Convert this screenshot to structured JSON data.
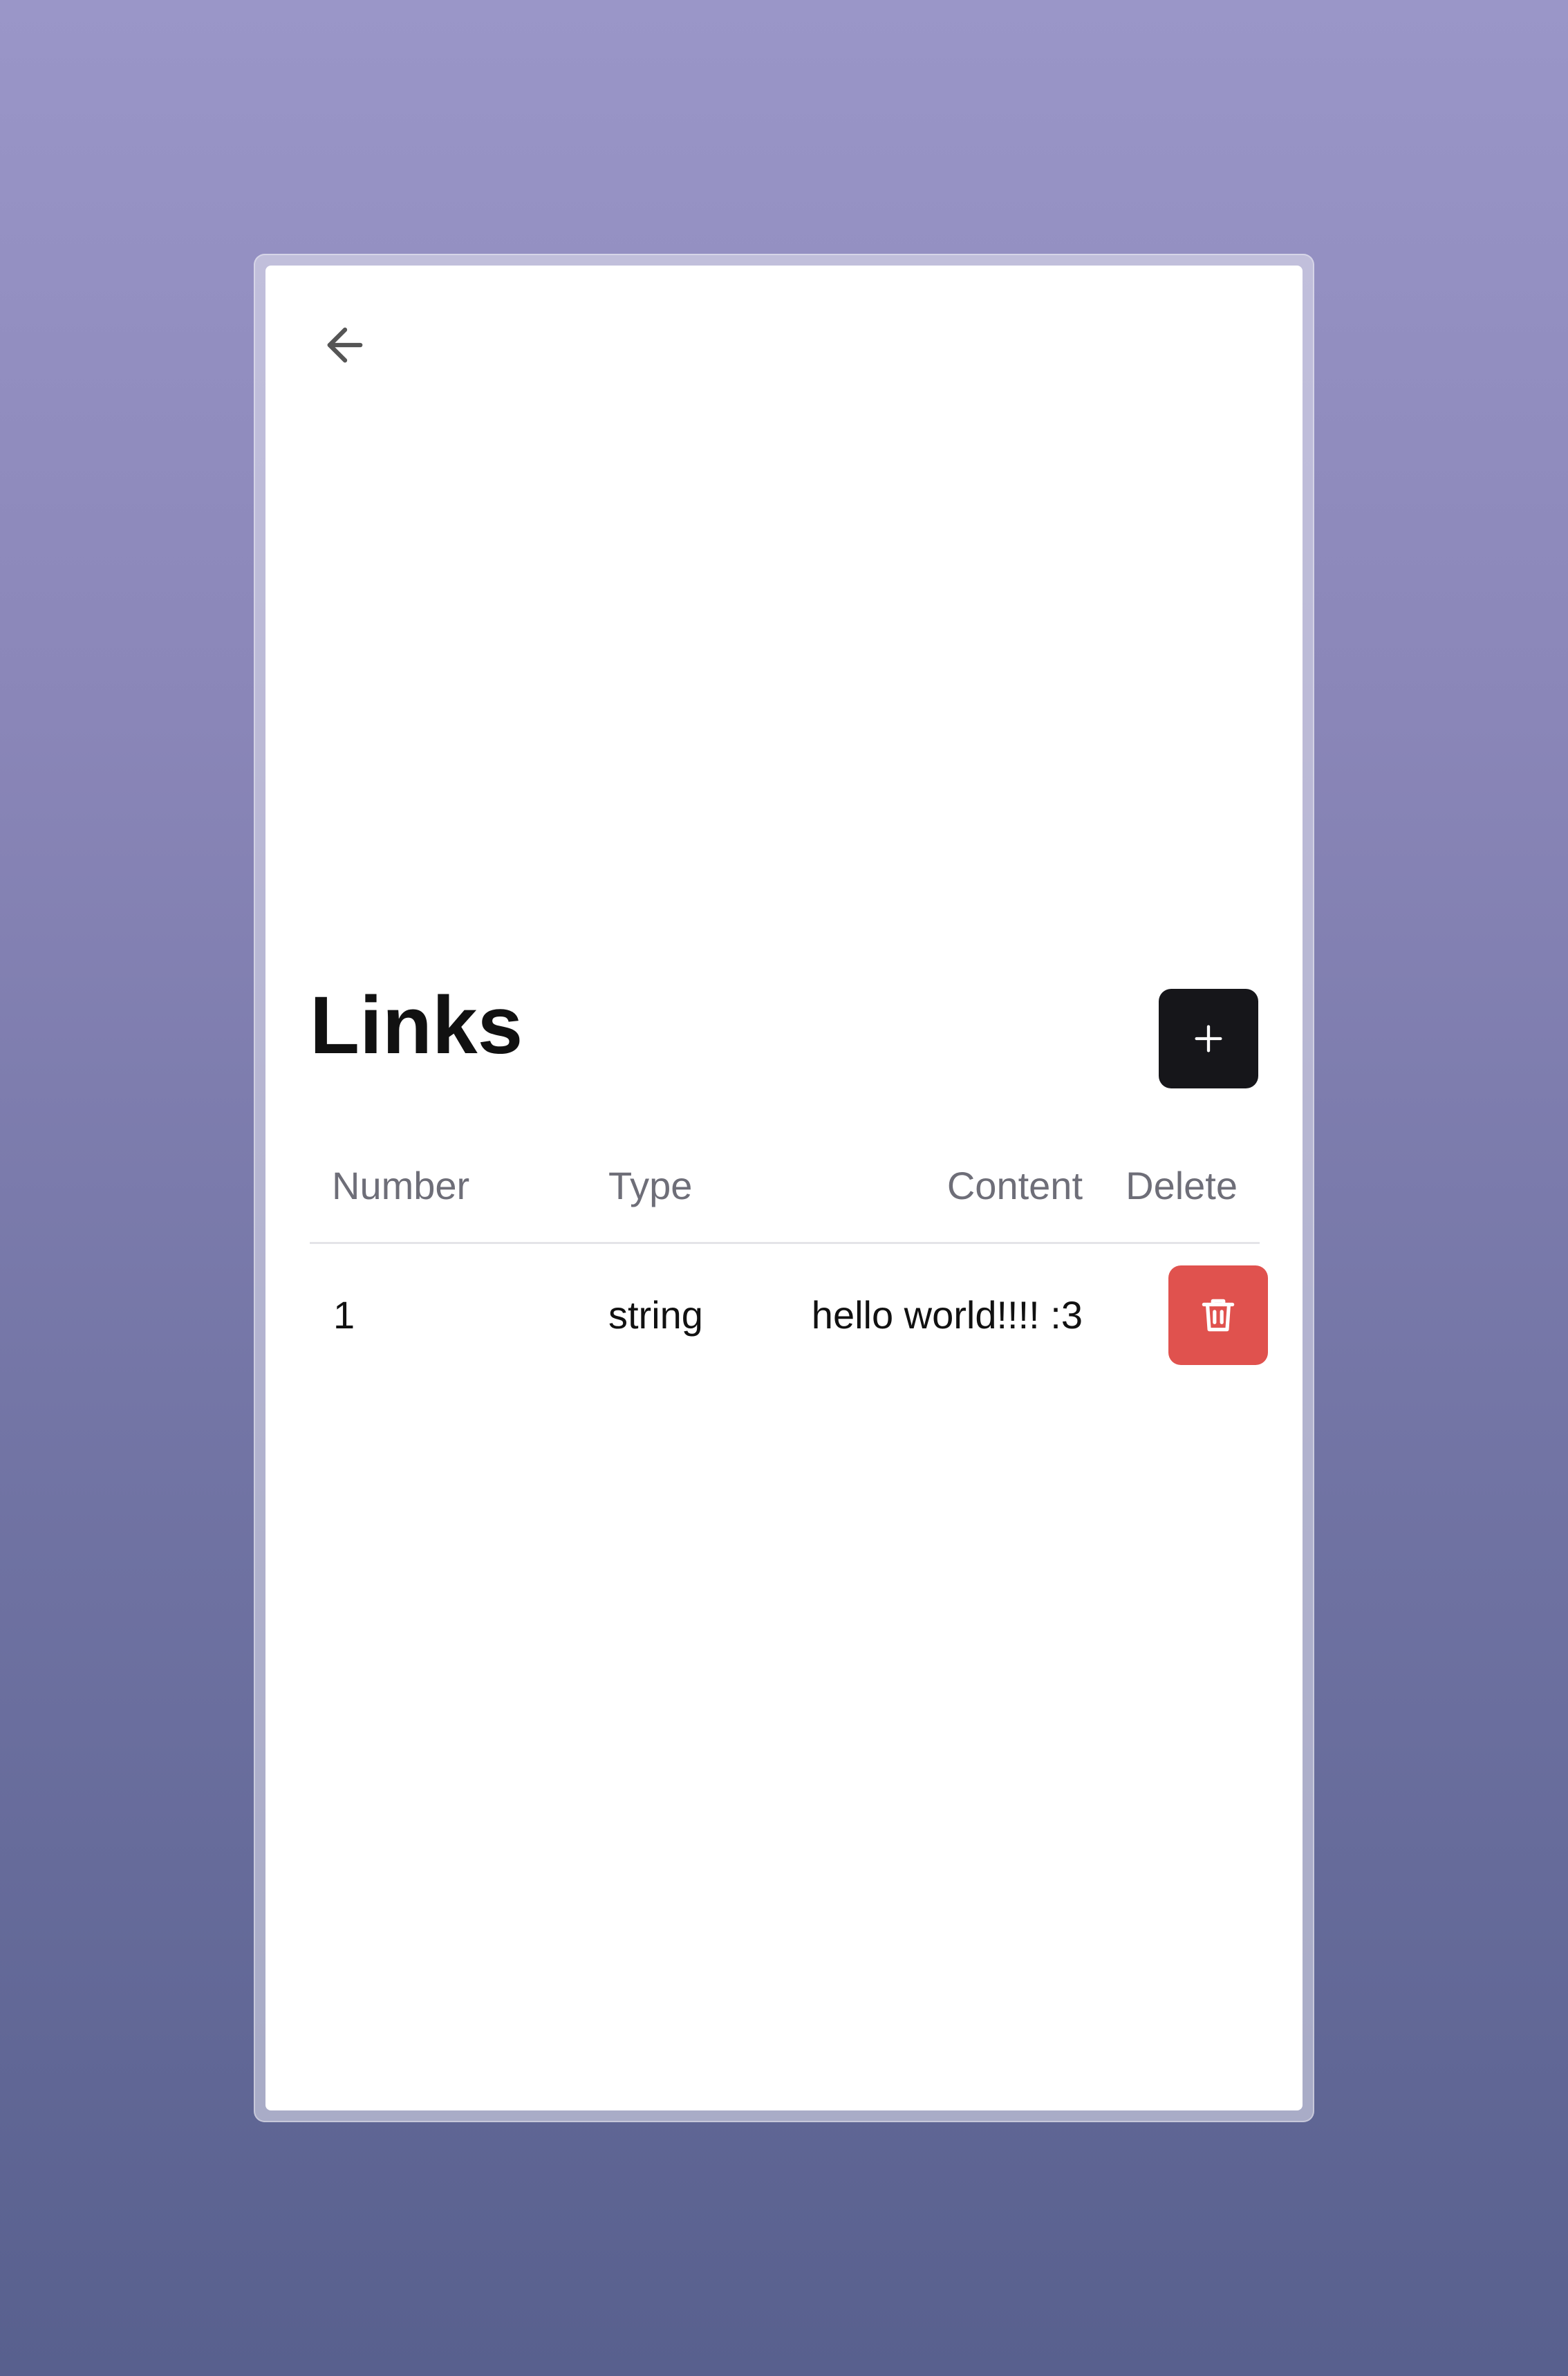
{
  "page": {
    "title": "Links",
    "back_icon": "arrow-left-icon",
    "add_icon": "plus-icon"
  },
  "table": {
    "headers": {
      "number": "Number",
      "type": "Type",
      "content": "Content",
      "delete": "Delete"
    },
    "rows": [
      {
        "number": "1",
        "type": "string",
        "content": "hello world!!!! :3",
        "delete_icon": "trash-icon"
      }
    ]
  },
  "colors": {
    "background_top": "#9a96c8",
    "background_bottom": "#58608e",
    "add_button": "#16161a",
    "delete_button": "#e0524e"
  }
}
